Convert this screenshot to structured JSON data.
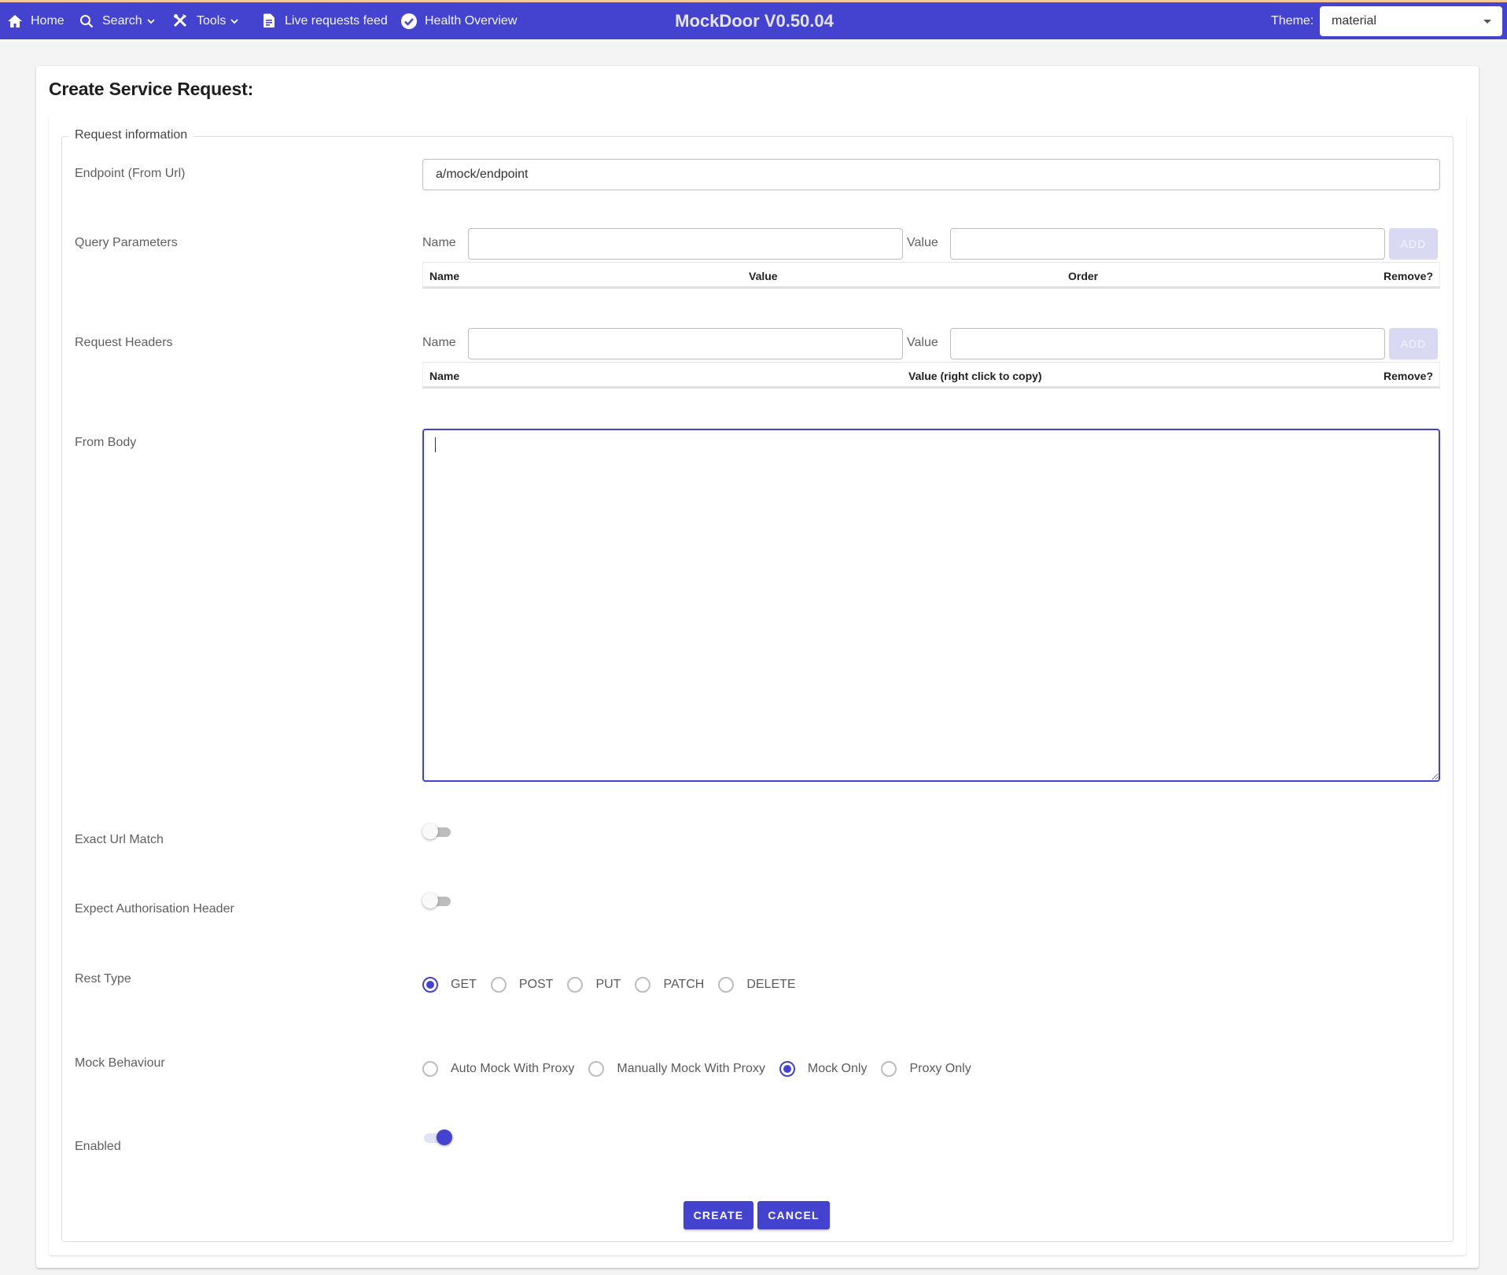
{
  "navbar": {
    "items": [
      {
        "label": "Home",
        "icon": "home-icon"
      },
      {
        "label": "Search",
        "icon": "search-icon",
        "dropdown": true
      },
      {
        "label": "Tools",
        "icon": "tools-icon",
        "dropdown": true
      },
      {
        "label": "Live requests feed",
        "icon": "document-icon"
      },
      {
        "label": "Health Overview",
        "icon": "check-circle-icon"
      }
    ],
    "brand": "MockDoor V0.50.04",
    "theme_label": "Theme:",
    "theme_value": "material"
  },
  "page": {
    "title": "Create Service Request:",
    "legend": "Request information"
  },
  "form": {
    "endpoint": {
      "label": "Endpoint (From Url)",
      "value": "a/mock/endpoint"
    },
    "query_parameters": {
      "label": "Query Parameters",
      "name_label": "Name",
      "name_value": "",
      "value_label": "Value",
      "value_value": "",
      "add_label": "ADD",
      "columns": [
        "Name",
        "Value",
        "Order",
        "Remove?"
      ],
      "rows": []
    },
    "request_headers": {
      "label": "Request Headers",
      "name_label": "Name",
      "name_value": "",
      "value_label": "Value",
      "value_value": "",
      "add_label": "ADD",
      "columns": [
        "Name",
        "Value (right click to copy)",
        "Remove?"
      ],
      "rows": []
    },
    "from_body": {
      "label": "From Body",
      "value": ""
    },
    "exact_url_match": {
      "label": "Exact Url Match",
      "checked": false
    },
    "expect_auth_header": {
      "label": "Expect Authorisation Header",
      "checked": false
    },
    "rest_type": {
      "label": "Rest Type",
      "options": [
        "GET",
        "POST",
        "PUT",
        "PATCH",
        "DELETE"
      ],
      "selected": "GET"
    },
    "mock_behaviour": {
      "label": "Mock Behaviour",
      "options": [
        "Auto Mock With Proxy",
        "Manually Mock With Proxy",
        "Mock Only",
        "Proxy Only"
      ],
      "selected": "Mock Only"
    },
    "enabled": {
      "label": "Enabled",
      "checked": true
    }
  },
  "actions": {
    "create_label": "CREATE",
    "cancel_label": "CANCEL"
  },
  "colors": {
    "accent": "#4443cf",
    "add_disabled_bg": "#d9d9f3"
  }
}
